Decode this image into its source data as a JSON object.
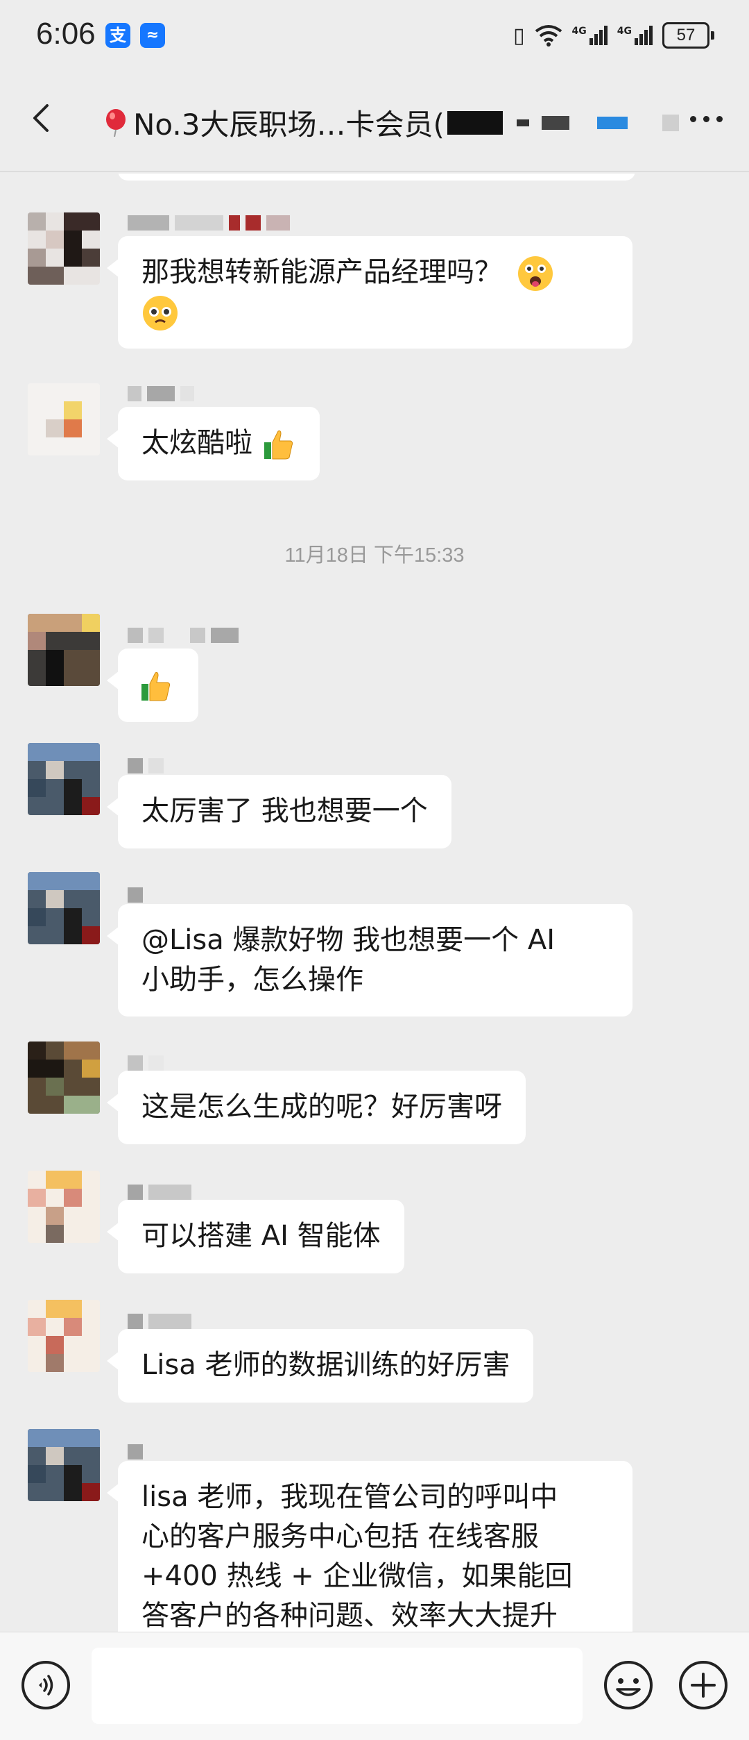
{
  "status_bar": {
    "time": "6:06",
    "badge_alipay": "支",
    "network_1": "4G",
    "network_2": "4G",
    "battery": "57"
  },
  "header": {
    "title": "No.3大辰职场…卡会员("
  },
  "date_divider": "11月18日 下午15:33",
  "messages": [
    {
      "text": "那我想转新能源产品经理吗？"
    },
    {
      "text": "太炫酷啦"
    },
    {
      "text": ""
    },
    {
      "text": "太厉害了 我也想要一个"
    },
    {
      "text_line1": "@Lisa 爆款好物  我也想要一个 AI",
      "text_line2": "小助手，怎么操作"
    },
    {
      "text": "这是怎么生成的呢？好厉害呀"
    },
    {
      "text": "可以搭建 AI 智能体"
    },
    {
      "text": "Lisa 老师的数据训练的好厉害"
    },
    {
      "text_line1": "lisa 老师，我现在管公司的呼叫中",
      "text_line2": "心的客户服务中心包括 在线客服",
      "text_line3": "+400 热线 + 企业微信，如果能回",
      "text_line4": "答客户的各种问题、效率大大提升"
    }
  ],
  "input": {
    "placeholder": ""
  },
  "colors": {
    "background": "#ededed",
    "bubble": "#ffffff",
    "accent": "#1677ff"
  }
}
